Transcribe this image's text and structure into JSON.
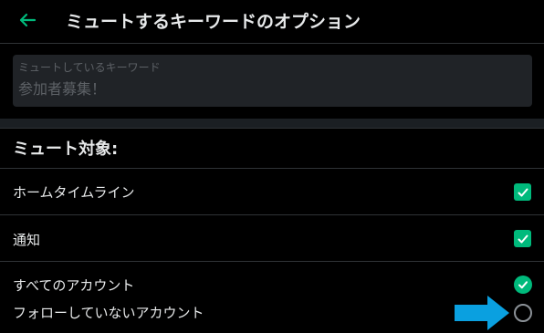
{
  "header": {
    "title": "ミュートするキーワードのオプション",
    "back_icon": "arrow-left-icon"
  },
  "keyword_field": {
    "label": "ミュートしているキーワード",
    "value": "参加者募集！"
  },
  "section": {
    "title": "ミュート対象:"
  },
  "options": [
    {
      "label": "ホームタイムライン",
      "checked": true
    },
    {
      "label": "通知",
      "checked": true
    },
    {
      "label": "すべてのアカウント",
      "checked": true
    },
    {
      "label": "フォローしていないアカウント",
      "checked": false
    }
  ],
  "colors": {
    "accent": "#00ba7c",
    "background": "#000000",
    "arrow_annotation": "#0aa0e0"
  }
}
